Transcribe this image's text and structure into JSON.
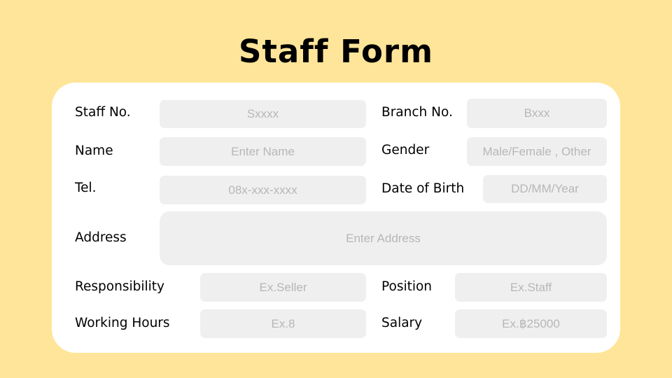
{
  "title": "Staff Form",
  "colors": {
    "background": "#FFE599",
    "card": "#FFFFFF",
    "field": "#EFEFEF",
    "placeholder": "#B7B7B7",
    "text": "#000000"
  },
  "fields": {
    "staff_no": {
      "label": "Staff No.",
      "value": "",
      "placeholder": "Sxxxx"
    },
    "branch_no": {
      "label": "Branch No.",
      "value": "",
      "placeholder": "Bxxx"
    },
    "name": {
      "label": "Name",
      "value": "",
      "placeholder": "Enter Name"
    },
    "gender": {
      "label": "Gender",
      "value": "",
      "placeholder": "Male/Female , Other"
    },
    "tel": {
      "label": "Tel.",
      "value": "",
      "placeholder": "08x-xxx-xxxx"
    },
    "dob": {
      "label": "Date of Birth",
      "value": "",
      "placeholder": "DD/MM/Year"
    },
    "address": {
      "label": "Address",
      "value": "",
      "placeholder": "Enter Address"
    },
    "responsibility": {
      "label": "Responsibility",
      "value": "",
      "placeholder": "Ex.Seller"
    },
    "position": {
      "label": "Position",
      "value": "",
      "placeholder": "Ex.Staff"
    },
    "working_hours": {
      "label": "Working Hours",
      "value": "",
      "placeholder": "Ex.8"
    },
    "salary": {
      "label": "Salary",
      "value": "",
      "placeholder": "Ex.฿25000"
    }
  }
}
